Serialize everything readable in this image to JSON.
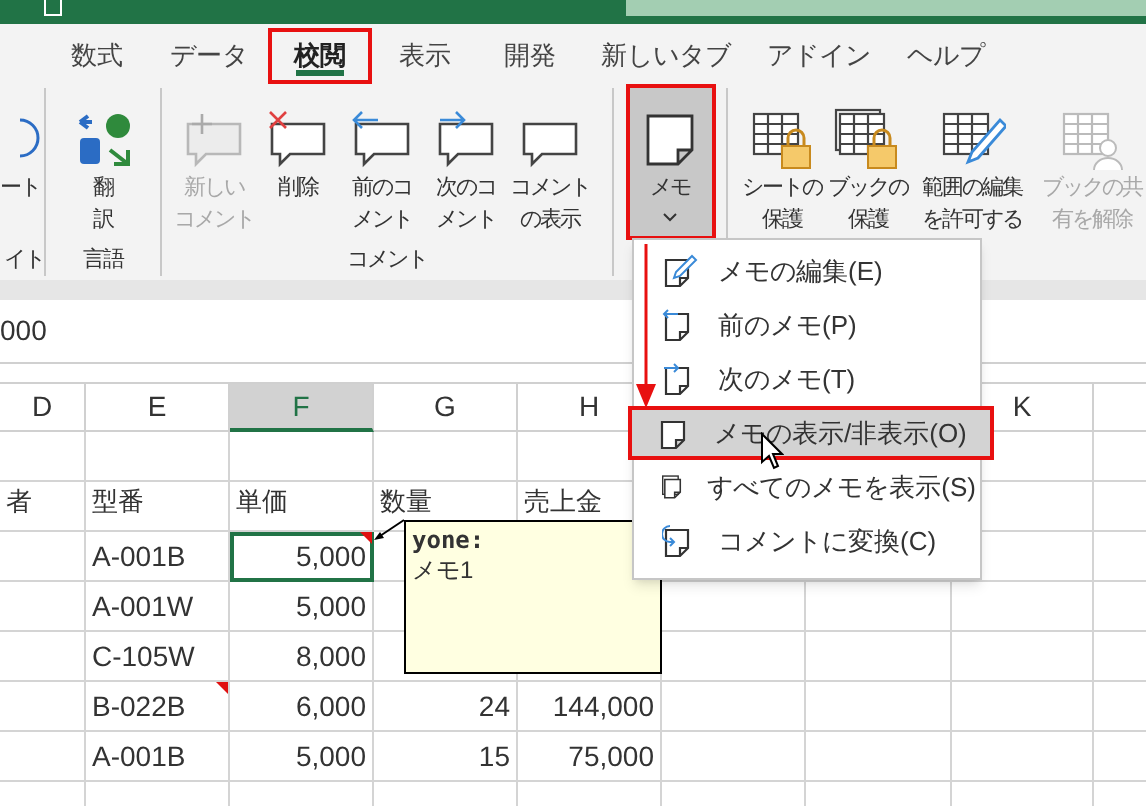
{
  "tabs": [
    {
      "label": "数式",
      "selected": false
    },
    {
      "label": "データ",
      "selected": false
    },
    {
      "label": "校閲",
      "selected": true
    },
    {
      "label": "表示",
      "selected": false
    },
    {
      "label": "開発",
      "selected": false
    },
    {
      "label": "新しいタブ",
      "selected": false
    },
    {
      "label": "アドイン",
      "selected": false
    },
    {
      "label": "ヘルプ",
      "selected": false
    }
  ],
  "ribbon": {
    "groups": [
      {
        "label": "イト",
        "buttons": [
          {
            "kind": "circle",
            "lines": [
              "ート"
            ],
            "disabled": false,
            "pressed": false
          }
        ]
      },
      {
        "label": "言語",
        "buttons": [
          {
            "kind": "translate",
            "lines": [
              "翻",
              "訳"
            ],
            "disabled": false,
            "pressed": false
          }
        ]
      },
      {
        "label": "コメント",
        "buttons": [
          {
            "kind": "new-comment",
            "lines": [
              "新しい",
              "コメント"
            ],
            "disabled": true,
            "pressed": false
          },
          {
            "kind": "delete-comment",
            "lines": [
              "削除"
            ],
            "disabled": false,
            "pressed": false
          },
          {
            "kind": "prev-comment",
            "lines": [
              "前のコ",
              "メント"
            ],
            "disabled": false,
            "pressed": false
          },
          {
            "kind": "next-comment",
            "lines": [
              "次のコ",
              "メント"
            ],
            "disabled": false,
            "pressed": false
          },
          {
            "kind": "show-comment",
            "lines": [
              "コメント",
              "の表示"
            ],
            "disabled": false,
            "pressed": false
          }
        ]
      },
      {
        "buttons": [
          {
            "kind": "memo",
            "lines": [
              "メモ"
            ],
            "disabled": false,
            "pressed": true
          }
        ]
      },
      {
        "buttons": [
          {
            "kind": "protect-sheet",
            "lines": [
              "シートの",
              "保護"
            ],
            "disabled": false,
            "pressed": false
          },
          {
            "kind": "protect-book",
            "lines": [
              "ブックの",
              "保護"
            ],
            "disabled": false,
            "pressed": false
          },
          {
            "kind": "allow-edit",
            "lines": [
              "範囲の編集",
              "を許可する"
            ],
            "disabled": false,
            "pressed": false
          },
          {
            "kind": "unshare",
            "lines": [
              "ブックの共",
              "有を解除"
            ],
            "disabled": true,
            "pressed": false
          }
        ]
      }
    ]
  },
  "formula_bar": {
    "value": "000"
  },
  "columns": [
    {
      "label": "D",
      "selected": false
    },
    {
      "label": "E",
      "selected": false
    },
    {
      "label": "F",
      "selected": true
    },
    {
      "label": "G",
      "selected": false
    },
    {
      "label": "H",
      "selected": false
    },
    {},
    {},
    {
      "label": "K",
      "selected": false
    },
    {}
  ],
  "rows": [
    {
      "kind": "blank",
      "cells": []
    },
    {
      "kind": "header",
      "cells": [
        {
          "text": "者"
        },
        {
          "text": "型番"
        },
        {
          "text": "単価"
        },
        {
          "text": "数量"
        },
        {
          "text": "売上金"
        }
      ]
    },
    {
      "kind": "data",
      "cells": [
        {},
        {
          "text": "A-001B",
          "comment": false,
          "selected": false
        },
        {
          "text": "5,000",
          "comment": true,
          "selected": true
        }
      ]
    },
    {
      "kind": "data",
      "cells": [
        {},
        {
          "text": "A-001W",
          "comment": false,
          "selected": false
        },
        {
          "text": "5,000",
          "comment": false,
          "selected": false
        }
      ]
    },
    {
      "kind": "data",
      "cells": [
        {},
        {
          "text": "C-105W",
          "comment": false,
          "selected": false
        },
        {
          "text": "8,000",
          "comment": false,
          "selected": false
        }
      ]
    },
    {
      "kind": "data",
      "cells": [
        {},
        {
          "text": "B-022B",
          "comment": true,
          "selected": false
        },
        {
          "text": "6,000",
          "comment": false,
          "selected": false
        },
        {
          "text": "24",
          "comment": false,
          "selected": false
        },
        {
          "text": "144,000",
          "comment": false,
          "selected": false
        }
      ]
    },
    {
      "kind": "data",
      "cells": [
        {},
        {
          "text": "A-001B",
          "comment": false,
          "selected": false
        },
        {
          "text": "5,000",
          "comment": false,
          "selected": false
        },
        {
          "text": "15",
          "comment": false,
          "selected": false
        },
        {
          "text": "75,000",
          "comment": false,
          "selected": false
        }
      ]
    },
    {
      "kind": "blank",
      "cells": []
    }
  ],
  "note": {
    "author": "yone:",
    "text": "メモ1"
  },
  "menu": {
    "items": [
      {
        "kind": "edit",
        "label": "メモの編集(E)",
        "selected": false
      },
      {
        "kind": "prev",
        "label": "前のメモ(P)",
        "selected": false
      },
      {
        "kind": "next",
        "label": "次のメモ(T)",
        "selected": false
      },
      {
        "kind": "note",
        "label": "メモの表示/非表示(O)",
        "selected": true
      },
      {
        "kind": "notes",
        "label": "すべてのメモを表示(S)",
        "selected": false
      },
      {
        "kind": "convert",
        "label": "コメントに変換(C)",
        "selected": false
      }
    ]
  }
}
